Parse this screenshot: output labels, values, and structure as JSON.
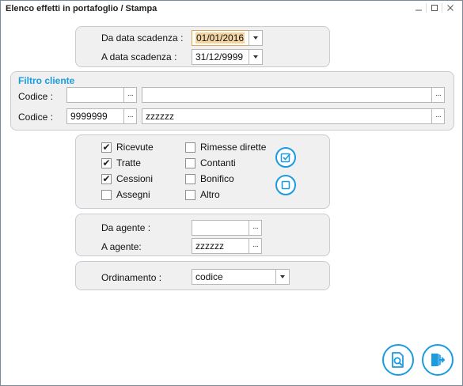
{
  "window": {
    "title": "Elenco effetti in portafoglio / Stampa",
    "controls": [
      "—",
      "☐",
      "✕"
    ]
  },
  "dates": {
    "from_label": "Da data scadenza :",
    "from_value": "01/01/2016",
    "to_label": "A data scadenza :",
    "to_value": "31/12/9999"
  },
  "client_filter": {
    "title": "Filtro cliente",
    "row1": {
      "label": "Codice :",
      "code": "",
      "name": ""
    },
    "row2": {
      "label": "Codice :",
      "code": "9999999",
      "name": "zzzzzz"
    },
    "ellipsis": "···"
  },
  "types": {
    "ricevute": {
      "label": "Ricevute",
      "checked": true
    },
    "tratte": {
      "label": "Tratte",
      "checked": true
    },
    "cessioni": {
      "label": "Cessioni",
      "checked": true
    },
    "assegni": {
      "label": "Assegni",
      "checked": false
    },
    "rimesse": {
      "label": "Rimesse dirette",
      "checked": false
    },
    "contanti": {
      "label": "Contanti",
      "checked": false
    },
    "bonifico": {
      "label": "Bonifico",
      "checked": false
    },
    "altro": {
      "label": "Altro",
      "checked": false
    },
    "check_mark": "✔"
  },
  "agents": {
    "from_label": "Da agente :",
    "from_value": "",
    "to_label": "A agente:",
    "to_value": "zzzzzz"
  },
  "order": {
    "label": "Ordinamento :",
    "value": "codice"
  },
  "colors": {
    "accent": "#1b9be0",
    "panel_bg": "#f0f0f0",
    "active_border": "#e3a64f"
  }
}
